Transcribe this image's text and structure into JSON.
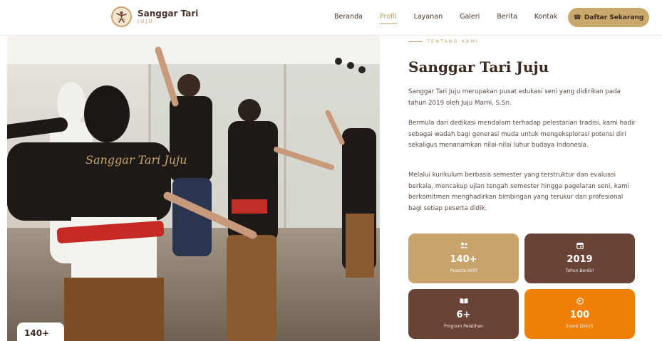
{
  "brand": {
    "name": "Sanggar Tari",
    "sub": "JUJU"
  },
  "nav": {
    "items": [
      "Beranda",
      "Profil",
      "Layanan",
      "Galeri",
      "Berita",
      "Kontak"
    ],
    "active": "Profil",
    "cta_label": "Daftar Sekarang",
    "cta_icon": "whatsapp-icon"
  },
  "photo": {
    "corner_stat": "140+"
  },
  "about": {
    "eyebrow": "TENTANG KAMI",
    "title": "Sanggar Tari Juju",
    "paragraphs": [
      "Sanggar Tari Juju merupakan pusat edukasi seni yang didirikan pada tahun 2019 oleh Juju Marni, S.Sn.",
      "Bermula dari dedikasi mendalam terhadap pelestarian tradisi, kami hadir sebagai wadah bagi generasi muda untuk mengeksplorasi potensi diri sekaligus menanamkan nilai-nilai luhur budaya Indonesia.",
      "Melalui kurikulum berbasis semester yang terstruktur dan evaluasi berkala, mencakup ujian tengah semester hingga pagelaran seni, kami berkomitmen menghadirkan bimbingan yang terukur dan profesional bagi setiap peserta didik."
    ]
  },
  "stats": [
    {
      "icon": "users-icon",
      "value": "140+",
      "label": "Peserta Aktif"
    },
    {
      "icon": "calendar-icon",
      "value": "2019",
      "label": "Tahun Berdiri"
    },
    {
      "icon": "book-icon",
      "value": "6+",
      "label": "Program Pelatihan"
    },
    {
      "icon": "globe-icon",
      "value": "100",
      "label": "Event Diikuti"
    }
  ],
  "colors": {
    "gold": "#c9a86b",
    "brown": "#6a4337",
    "orange": "#f0800a",
    "dark": "#3d2a1f"
  }
}
